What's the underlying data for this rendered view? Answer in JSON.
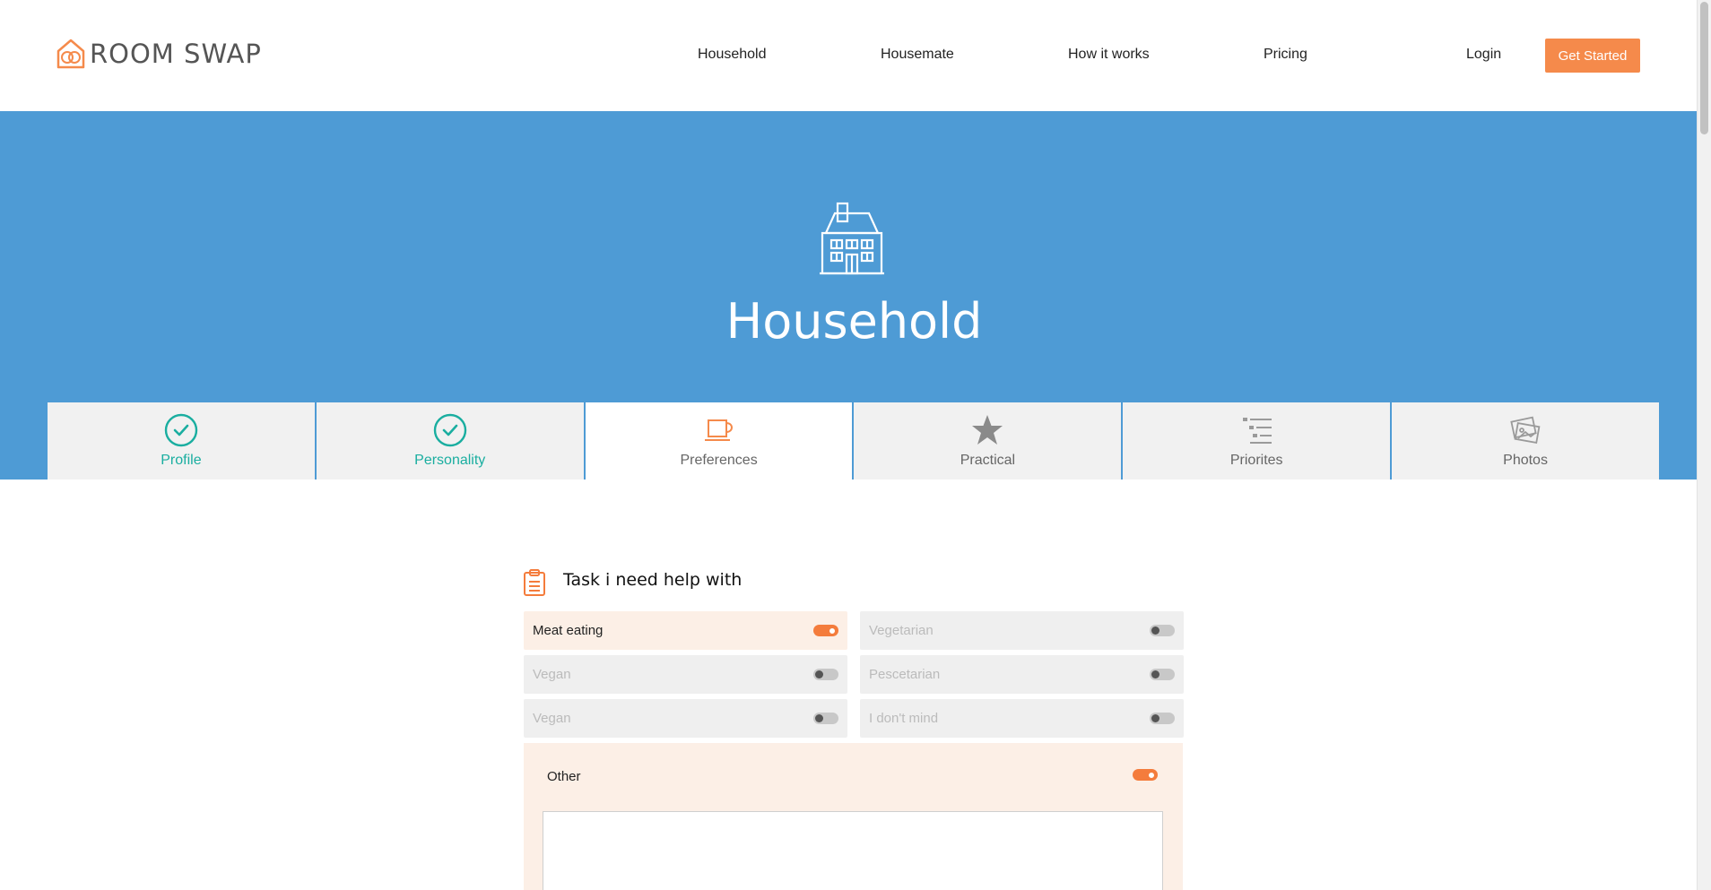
{
  "brand": {
    "name": "ROOM SWAP"
  },
  "nav": {
    "items": [
      {
        "label": "Household"
      },
      {
        "label": "Housemate"
      },
      {
        "label": "How it works"
      },
      {
        "label": "Pricing"
      }
    ],
    "login": "Login",
    "cta": "Get Started"
  },
  "hero": {
    "title": "Household",
    "icon": "house-icon"
  },
  "tabs": [
    {
      "label": "Profile",
      "icon": "check-circle-icon",
      "state": "completed"
    },
    {
      "label": "Personality",
      "icon": "check-circle-icon",
      "state": "completed"
    },
    {
      "label": "Preferences",
      "icon": "mug-icon",
      "state": "active"
    },
    {
      "label": "Practical",
      "icon": "star-icon",
      "state": "pending"
    },
    {
      "label": "Priorites",
      "icon": "list-icon",
      "state": "pending"
    },
    {
      "label": "Photos",
      "icon": "photos-icon",
      "state": "pending"
    }
  ],
  "section": {
    "title": "Task i need help with",
    "icon": "clipboard-icon",
    "options": [
      {
        "label": "Meat eating",
        "on": true
      },
      {
        "label": "Vegetarian",
        "on": false
      },
      {
        "label": "Vegan",
        "on": false
      },
      {
        "label": "Pescetarian",
        "on": false
      },
      {
        "label": "Vegan",
        "on": false
      },
      {
        "label": "I don't mind",
        "on": false
      }
    ],
    "other": {
      "label": "Other",
      "on": true,
      "value": ""
    }
  },
  "colors": {
    "accent": "#f58a4b",
    "hero_bg": "#4e9bd5",
    "completed": "#1aaea0"
  }
}
